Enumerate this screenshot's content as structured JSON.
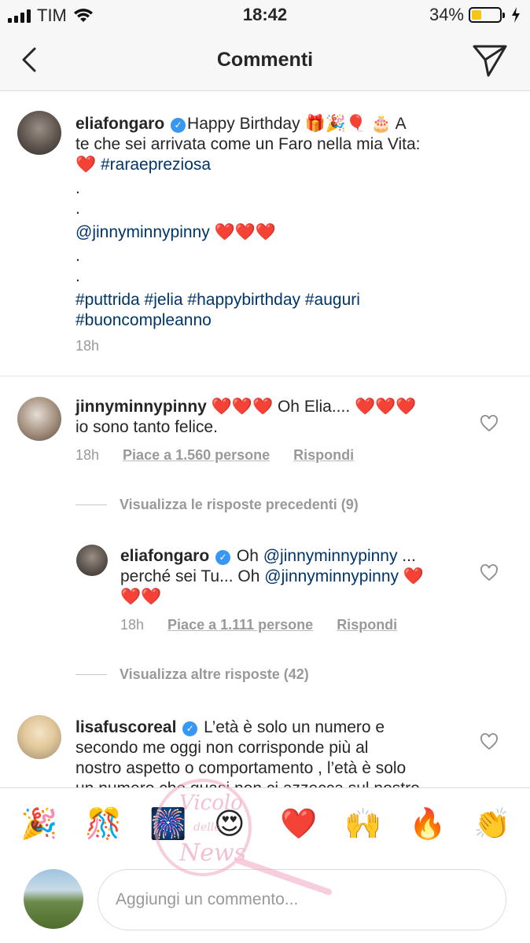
{
  "status_bar": {
    "carrier": "TIM",
    "time": "18:42",
    "battery_percent": "34%",
    "battery_level": 0.34,
    "icons": [
      "signal-icon",
      "wifi-icon",
      "battery-icon",
      "charging-icon"
    ]
  },
  "nav": {
    "title": "Commenti",
    "back_icon": "chevron-left-icon",
    "send_icon": "paper-plane-icon"
  },
  "comments": [
    {
      "username": "eliafongaro",
      "verified": true,
      "text_line1_a": "Happy Birthday ",
      "emojis_line1": "🎁🎉🎈 🎂",
      "text_line1_b": " A",
      "text_line2": "te che sei arrivata come un Faro nella mia Vita:",
      "line3_emoji": "❤️",
      "line3_tag": "#raraepreziosa",
      "dot1": ".",
      "dot2": ".",
      "mention": "@jinnyminnypinny",
      "mention_hearts": "❤️❤️❤️",
      "dot3": ".",
      "dot4": ".",
      "hashtags_line1": "#puttrida #jelia #happybirthday #auguri",
      "hashtags_line2": "#buoncompleanno",
      "time": "18h"
    },
    {
      "username": "jinnyminnypinny",
      "hearts_a": "❤️❤️❤️",
      "text_a": " Oh Elia.... ",
      "hearts_b": "❤️❤️❤️",
      "text_line2": "io sono tanto felice.",
      "time": "18h",
      "likes": "Piace a 1.560 persone",
      "reply": "Rispondi"
    }
  ],
  "view_previous_replies": "Visualizza le risposte precedenti (9)",
  "reply": {
    "username": "eliafongaro",
    "verified": true,
    "text_a": "Oh ",
    "mention_a": "@jinnyminnypinny",
    "text_b": " ...",
    "line2_text": "perché sei Tu... Oh ",
    "mention_b": "@jinnyminnypinny",
    "line2_heart": " ❤️",
    "line3_hearts": "❤️❤️",
    "time": "18h",
    "likes": "Piace a 1.111 persone",
    "reply": "Rispondi"
  },
  "view_more_replies": "Visualizza altre risposte (42)",
  "last_comment": {
    "username": "lisafuscoreal",
    "verified": true,
    "line1": "L’età è solo un numero e",
    "line2": "secondo me oggi non corrisponde più al",
    "line3": "nostro aspetto o comportamento , l’età è solo",
    "line4": "un numero che quasi non ci azzecca sul nostro"
  },
  "emoji_bar": [
    "🎉",
    "🎊",
    "🎆",
    "😍",
    "❤️",
    "🙌",
    "🔥",
    "👏"
  ],
  "input": {
    "placeholder": "Aggiungi un commento..."
  },
  "watermark": {
    "line1": "Vicolo",
    "line2": "delle",
    "line3": "News"
  },
  "colors": {
    "accent_blue": "#3897f0",
    "tag_blue": "#003569",
    "heart_red": "#e8191f",
    "meta_gray": "#999999",
    "battery_yellow": "#f5c518"
  }
}
